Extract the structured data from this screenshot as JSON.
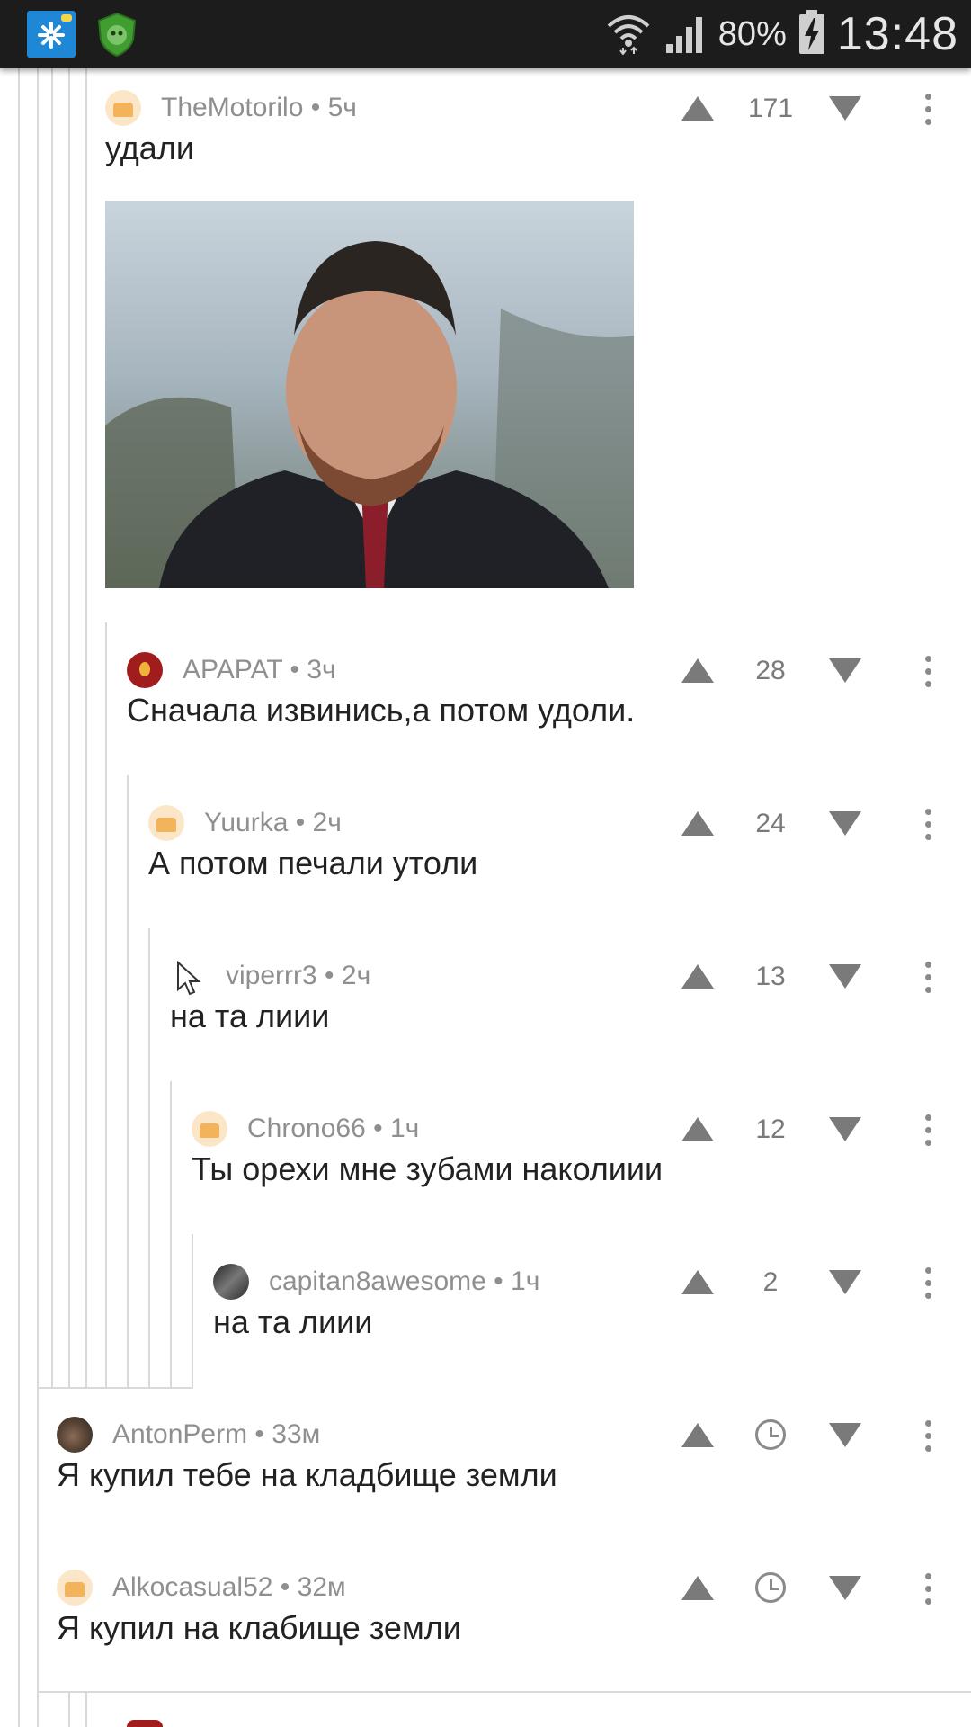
{
  "status_bar": {
    "battery_percent": "80%",
    "time": "13:48"
  },
  "comments": [
    {
      "author": "TheMotorilo",
      "time": "5ч",
      "text": "удали",
      "votes": "171",
      "avatar": "default"
    },
    {
      "author": "APAPAT",
      "time": "3ч",
      "text": "Сначала извинись,а потом удоли.",
      "votes": "28",
      "avatar": "apapat"
    },
    {
      "author": "Yuurka",
      "time": "2ч",
      "text": "А потом печали утоли",
      "votes": "24",
      "avatar": "default"
    },
    {
      "author": "viperrr3",
      "time": "2ч",
      "text": "на та лиии",
      "votes": "13",
      "avatar": "none"
    },
    {
      "author": "Chrono66",
      "time": "1ч",
      "text": "Ты орехи мне зубами наколиии",
      "votes": "12",
      "avatar": "default"
    },
    {
      "author": "capitan8awesome",
      "time": "1ч",
      "text": "на та лиии",
      "votes": "2",
      "avatar": "capitan"
    },
    {
      "author": "AntonPerm",
      "time": "33м",
      "text": "Я купил тебе на кладбище земли",
      "votes": "",
      "avatar": "anton"
    },
    {
      "author": "Alkocasual52",
      "time": "32м",
      "text": "Я купил на клабище земли",
      "votes": "",
      "avatar": "default"
    }
  ],
  "icons": [
    "upvote-icon",
    "downvote-icon",
    "more-icon",
    "clock-icon",
    "cursor-icon"
  ]
}
